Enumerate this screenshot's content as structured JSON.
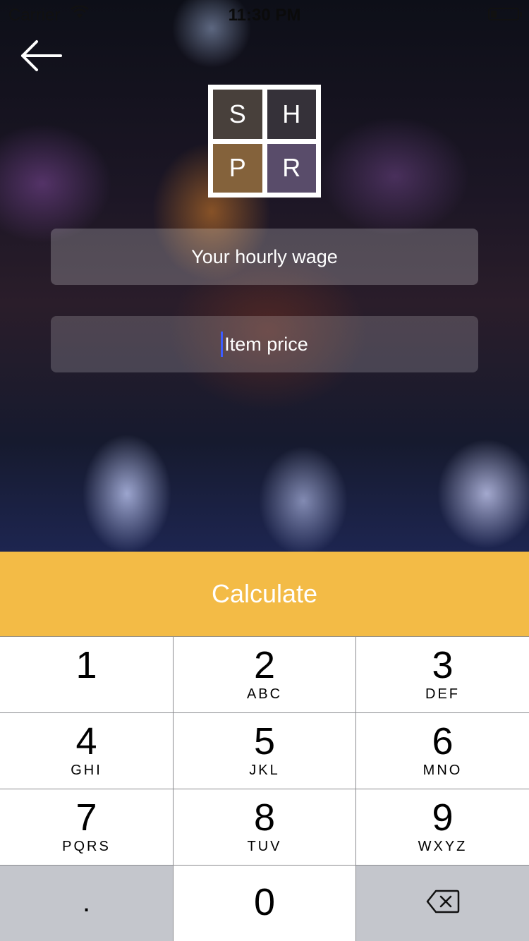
{
  "status_bar": {
    "carrier": "Carrier",
    "time": "11:30 PM"
  },
  "logo": {
    "letters": [
      "S",
      "H",
      "P",
      "R"
    ]
  },
  "form": {
    "wage_placeholder": "Your hourly wage",
    "price_placeholder": "Item price"
  },
  "calculate_label": "Calculate",
  "keypad": {
    "keys": [
      {
        "num": "1",
        "letters": ""
      },
      {
        "num": "2",
        "letters": "ABC"
      },
      {
        "num": "3",
        "letters": "DEF"
      },
      {
        "num": "4",
        "letters": "GHI"
      },
      {
        "num": "5",
        "letters": "JKL"
      },
      {
        "num": "6",
        "letters": "MNO"
      },
      {
        "num": "7",
        "letters": "PQRS"
      },
      {
        "num": "8",
        "letters": "TUV"
      },
      {
        "num": "9",
        "letters": "WXYZ"
      }
    ],
    "decimal": ".",
    "zero": "0"
  },
  "icons": {
    "back": "back-arrow-icon",
    "delete": "delete-backspace-icon",
    "wifi": "wifi-icon",
    "battery": "battery-icon"
  },
  "colors": {
    "accent": "#f3bb46",
    "cursor": "#3d5cff"
  }
}
